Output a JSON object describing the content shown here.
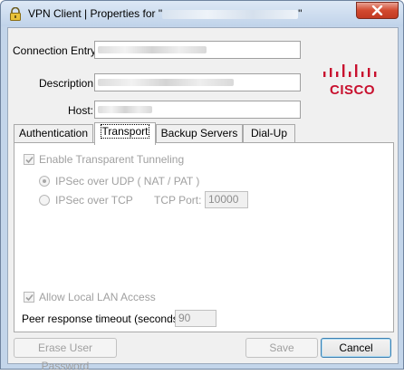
{
  "window": {
    "title_prefix": "VPN Client  |  Properties for \"",
    "title_suffix": "\"",
    "close_label": ""
  },
  "form": {
    "connection_entry_label": "Connection Entry:",
    "description_label": "Description:",
    "host_label": "Host:"
  },
  "logo": {
    "text": "CISCO",
    "color": "#c8102e"
  },
  "tabs": [
    {
      "label": "Authentication"
    },
    {
      "label": "Transport"
    },
    {
      "label": "Backup Servers"
    },
    {
      "label": "Dial-Up"
    }
  ],
  "transport": {
    "enable_tunneling_label": "Enable Transparent Tunneling",
    "enable_tunneling_checked": true,
    "ipsec_udp_label": "IPSec over UDP ( NAT / PAT )",
    "ipsec_udp_selected": true,
    "ipsec_tcp_label": "IPSec over TCP",
    "tcp_port_label": "TCP Port:",
    "tcp_port_value": "10000",
    "allow_lan_label": "Allow Local LAN Access",
    "allow_lan_checked": true
  },
  "peer": {
    "timeout_label": "Peer response timeout (seconds):",
    "timeout_value": "90"
  },
  "buttons": {
    "erase_label": "Erase User Password",
    "save_label": "Save",
    "cancel_label": "Cancel"
  }
}
